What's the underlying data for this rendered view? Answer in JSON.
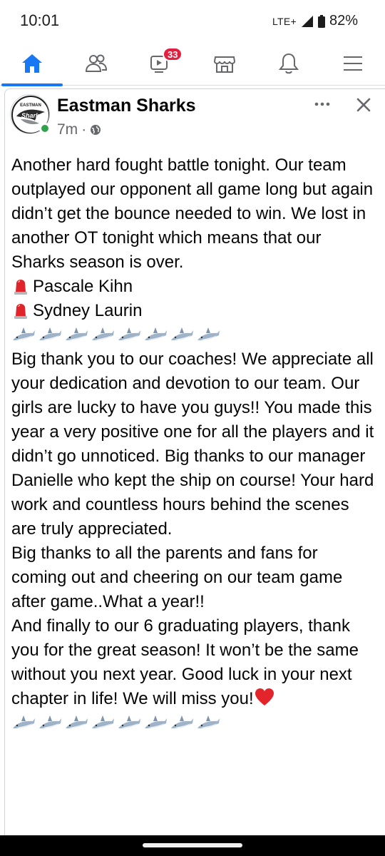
{
  "status_bar": {
    "time": "10:01",
    "network": "LTE+",
    "battery": "82%"
  },
  "nav": {
    "items": [
      {
        "name": "home",
        "icon": "home-icon",
        "active": true
      },
      {
        "name": "friends",
        "icon": "friends-icon"
      },
      {
        "name": "watch",
        "icon": "watch-icon",
        "badge": "33"
      },
      {
        "name": "marketplace",
        "icon": "marketplace-icon"
      },
      {
        "name": "notifications",
        "icon": "bell-icon"
      },
      {
        "name": "menu",
        "icon": "menu-icon"
      }
    ],
    "accent": "#1877f2",
    "badge_color": "#e41e3f"
  },
  "post": {
    "author": "Eastman Sharks",
    "avatar_text": "EASTMAN",
    "avatar_logo_text": "Sharks",
    "time": "7m",
    "separator": "·",
    "paragraph_1": "Another hard fought battle tonight.  Our team outplayed our opponent all game long but again didn’t get the bounce needed to win.  We lost in another OT tonight which means that our Sharks season is over.",
    "player_1": "Pascale Kihn",
    "player_2": "Sydney Laurin",
    "paragraph_2": "Big thank you to our coaches!  We appreciate all your dedication and devotion to our team.  Our girls are lucky to have you guys!! You made this year a very positive one for all the players and it didn’t go unnoticed.  Big thanks to our manager Danielle who kept the ship on course! Your hard work and countless hours behind the scenes are truly appreciated.",
    "paragraph_3": "Big thanks to all the parents and fans for coming out and cheering on our team game after game..What a year!!",
    "paragraph_4": "And finally to our 6 graduating players, thank you for the great season!  It won’t be the same without you next year.  Good luck in your next chapter in life!  We will miss you!",
    "shark_emoji_count": 8
  }
}
